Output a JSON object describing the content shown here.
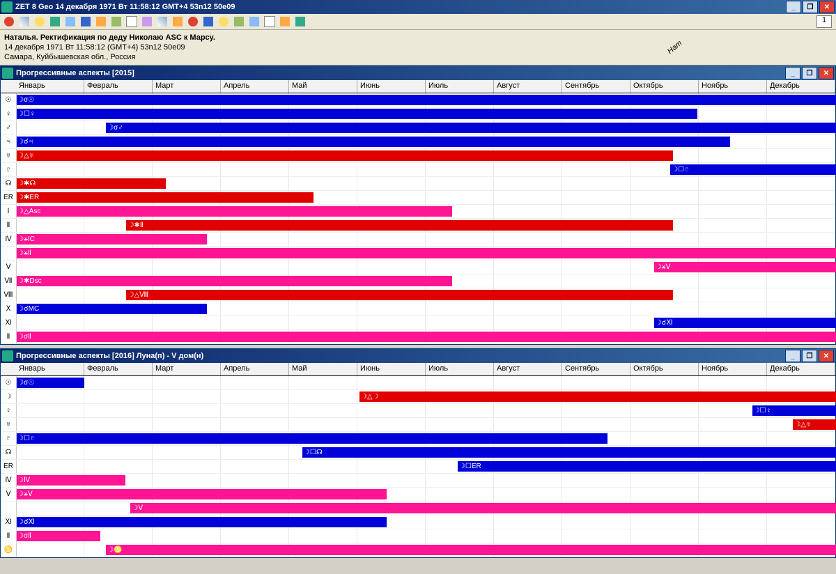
{
  "app_title": "ZET 8 Geo   14 декабря 1971  Вт  11:58:12 GMT+4  53n12   50e09",
  "page_number": "1",
  "header": {
    "line1": "Наталья. Ректификация по деду Николаю ASC к Марсу.",
    "line2": "14 декабря 1971  Вт   11:58:12  (GMT+4)  53n12   50e09",
    "line3": "Самара, Куйбышевская обл., Россия",
    "nat_label": "Нат"
  },
  "months": [
    "Январь",
    "Февраль",
    "Март",
    "Апрель",
    "Май",
    "Июнь",
    "Июль",
    "Август",
    "Сентябрь",
    "Октябрь",
    "Ноябрь",
    "Декабрь"
  ],
  "panel1": {
    "title": "Прогрессивные аспекты [2015]",
    "rows": [
      {
        "label": "☉",
        "bars": [
          {
            "color": "blue",
            "start": 0,
            "end": 100,
            "text": "☽σ☉"
          }
        ]
      },
      {
        "label": "♀",
        "bars": [
          {
            "color": "blue",
            "start": 0,
            "end": 83,
            "text": "☽☐♀"
          }
        ]
      },
      {
        "label": "♂",
        "bars": [
          {
            "color": "blue",
            "start": 11,
            "end": 100,
            "text": "☽σ♂",
            "label_at": 11
          }
        ]
      },
      {
        "label": "♃",
        "bars": [
          {
            "color": "blue",
            "start": 0,
            "end": 87,
            "text": "☽☌♃"
          }
        ]
      },
      {
        "label": "♅",
        "bars": [
          {
            "color": "red",
            "start": 0,
            "end": 80,
            "text": "☽△♅"
          }
        ]
      },
      {
        "label": "♇",
        "bars": [
          {
            "color": "blue",
            "start": 80,
            "end": 100,
            "text": "☽☐♇",
            "label_at": 80
          }
        ]
      },
      {
        "label": "☊",
        "bars": [
          {
            "color": "red",
            "start": 0,
            "end": 18,
            "text": "☽✱☊"
          }
        ]
      },
      {
        "label": "ER",
        "bars": [
          {
            "color": "red",
            "start": 0,
            "end": 36,
            "text": "☽✱ER"
          }
        ]
      },
      {
        "label": "Ⅰ",
        "bars": [
          {
            "color": "pink",
            "start": 0,
            "end": 53,
            "text": "☽△Asc"
          }
        ]
      },
      {
        "label": "Ⅱ",
        "bars": [
          {
            "color": "red",
            "start": 13.5,
            "end": 80,
            "text": "☽✱Ⅱ",
            "label_at": 13.5
          }
        ]
      },
      {
        "label": "Ⅳ",
        "bars": [
          {
            "color": "pink",
            "start": 0,
            "end": 23,
            "text": "☽⚹IC"
          }
        ]
      },
      {
        "label": "",
        "bars": [
          {
            "color": "pink",
            "start": 0,
            "end": 100,
            "text": "☽⚹Ⅱ"
          }
        ]
      },
      {
        "label": "Ⅴ",
        "bars": [
          {
            "color": "pink",
            "start": 78,
            "end": 100,
            "text": "☽⚹Ⅴ",
            "label_at": 78
          }
        ]
      },
      {
        "label": "Ⅶ",
        "bars": [
          {
            "color": "pink",
            "start": 0,
            "end": 53,
            "text": "☽✱Dsc"
          }
        ]
      },
      {
        "label": "Ⅷ",
        "bars": [
          {
            "color": "red",
            "start": 13.5,
            "end": 80,
            "text": "☽△Ⅷ",
            "label_at": 13.5
          }
        ]
      },
      {
        "label": "Ⅹ",
        "bars": [
          {
            "color": "blue",
            "start": 0,
            "end": 23,
            "text": "☽☌MC"
          }
        ]
      },
      {
        "label": "Ⅺ",
        "bars": [
          {
            "color": "blue",
            "start": 78,
            "end": 100,
            "text": "☽☌Ⅺ",
            "label_at": 78
          }
        ]
      },
      {
        "label": "Ⅱ",
        "bars": [
          {
            "color": "pink",
            "start": 0,
            "end": 100,
            "text": "☽σⅡ"
          }
        ]
      }
    ]
  },
  "panel2": {
    "title": "Прогрессивные аспекты [2016]    Луна(п) - V дом(н)",
    "rows": [
      {
        "label": "☉",
        "bars": [
          {
            "color": "blue",
            "start": 0,
            "end": 8,
            "text": "☽σ☉"
          }
        ]
      },
      {
        "label": "☽",
        "bars": [
          {
            "color": "red",
            "start": 42,
            "end": 100,
            "text": "☽△☽",
            "label_at": 42
          }
        ]
      },
      {
        "label": "♀",
        "bars": [
          {
            "color": "blue",
            "start": 90,
            "end": 100,
            "text": "☽☐♀",
            "label_at": 90
          }
        ]
      },
      {
        "label": "♅",
        "bars": [
          {
            "color": "red",
            "start": 95,
            "end": 100,
            "text": "☽△♅",
            "label_at": 95
          }
        ]
      },
      {
        "label": "♇",
        "bars": [
          {
            "color": "blue",
            "start": 0,
            "end": 72,
            "text": "☽☐♇"
          }
        ]
      },
      {
        "label": "☊",
        "bars": [
          {
            "color": "blue",
            "start": 35,
            "end": 100,
            "text": "☽☐☊",
            "label_at": 35
          }
        ]
      },
      {
        "label": "ER",
        "bars": [
          {
            "color": "blue",
            "start": 54,
            "end": 100,
            "text": "☽☐ER",
            "label_at": 54
          }
        ]
      },
      {
        "label": "Ⅳ",
        "bars": [
          {
            "color": "pink",
            "start": 0,
            "end": 13,
            "text": "☽Ⅳ"
          }
        ]
      },
      {
        "label": "Ⅴ",
        "bars": [
          {
            "color": "pink",
            "start": 0,
            "end": 45,
            "text": "☽⚹Ⅴ"
          }
        ]
      },
      {
        "label": "",
        "bars": [
          {
            "color": "pink",
            "start": 14,
            "end": 100,
            "text": "☽Ⅴ",
            "label_at": 14
          }
        ]
      },
      {
        "label": "Ⅺ",
        "bars": [
          {
            "color": "blue",
            "start": 0,
            "end": 45,
            "text": "☽☌Ⅺ"
          }
        ]
      },
      {
        "label": "Ⅱ",
        "bars": [
          {
            "color": "pink",
            "start": 0,
            "end": 10,
            "text": "☽σⅡ"
          }
        ]
      },
      {
        "label": "♋",
        "bars": [
          {
            "color": "pink",
            "start": 11,
            "end": 100,
            "text": "☽♋",
            "label_at": 11
          }
        ]
      }
    ]
  }
}
